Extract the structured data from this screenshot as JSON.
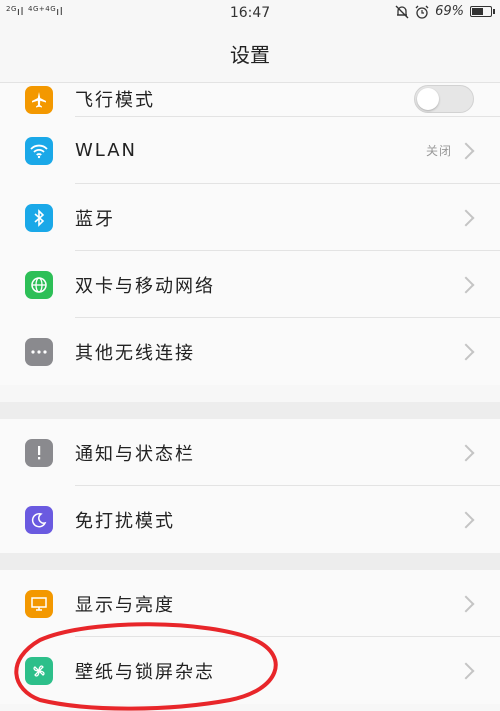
{
  "status": {
    "net_small": "2G",
    "net_small2": "4G+",
    "net_small3": "4G",
    "time": "16:47",
    "battery": "69%",
    "battery_level": 0.69
  },
  "header": {
    "title": "设置"
  },
  "colors": {
    "orange": "#f39800",
    "blue": "#1aa8e8",
    "green": "#2dbf57",
    "gray": "#8a8a8e",
    "purple": "#6a5ae0",
    "red_annotation": "#e8262a"
  },
  "groups": [
    {
      "items": [
        {
          "label": "飞行模式",
          "icon": "airplane-icon",
          "control": "toggle",
          "toggle_on": false
        },
        {
          "label": "WLAN",
          "icon": "wifi-icon",
          "value": "关闭"
        },
        {
          "label": "蓝牙",
          "icon": "bluetooth-icon"
        },
        {
          "label": "双卡与移动网络",
          "icon": "globe-icon"
        },
        {
          "label": "其他无线连接",
          "icon": "more-icon"
        }
      ]
    },
    {
      "items": [
        {
          "label": "通知与状态栏",
          "icon": "notification-icon"
        },
        {
          "label": "免打扰模式",
          "icon": "moon-icon"
        }
      ]
    },
    {
      "items": [
        {
          "label": "显示与亮度",
          "icon": "display-icon"
        },
        {
          "label": "壁纸与锁屏杂志",
          "icon": "pinwheel-icon"
        }
      ]
    }
  ]
}
